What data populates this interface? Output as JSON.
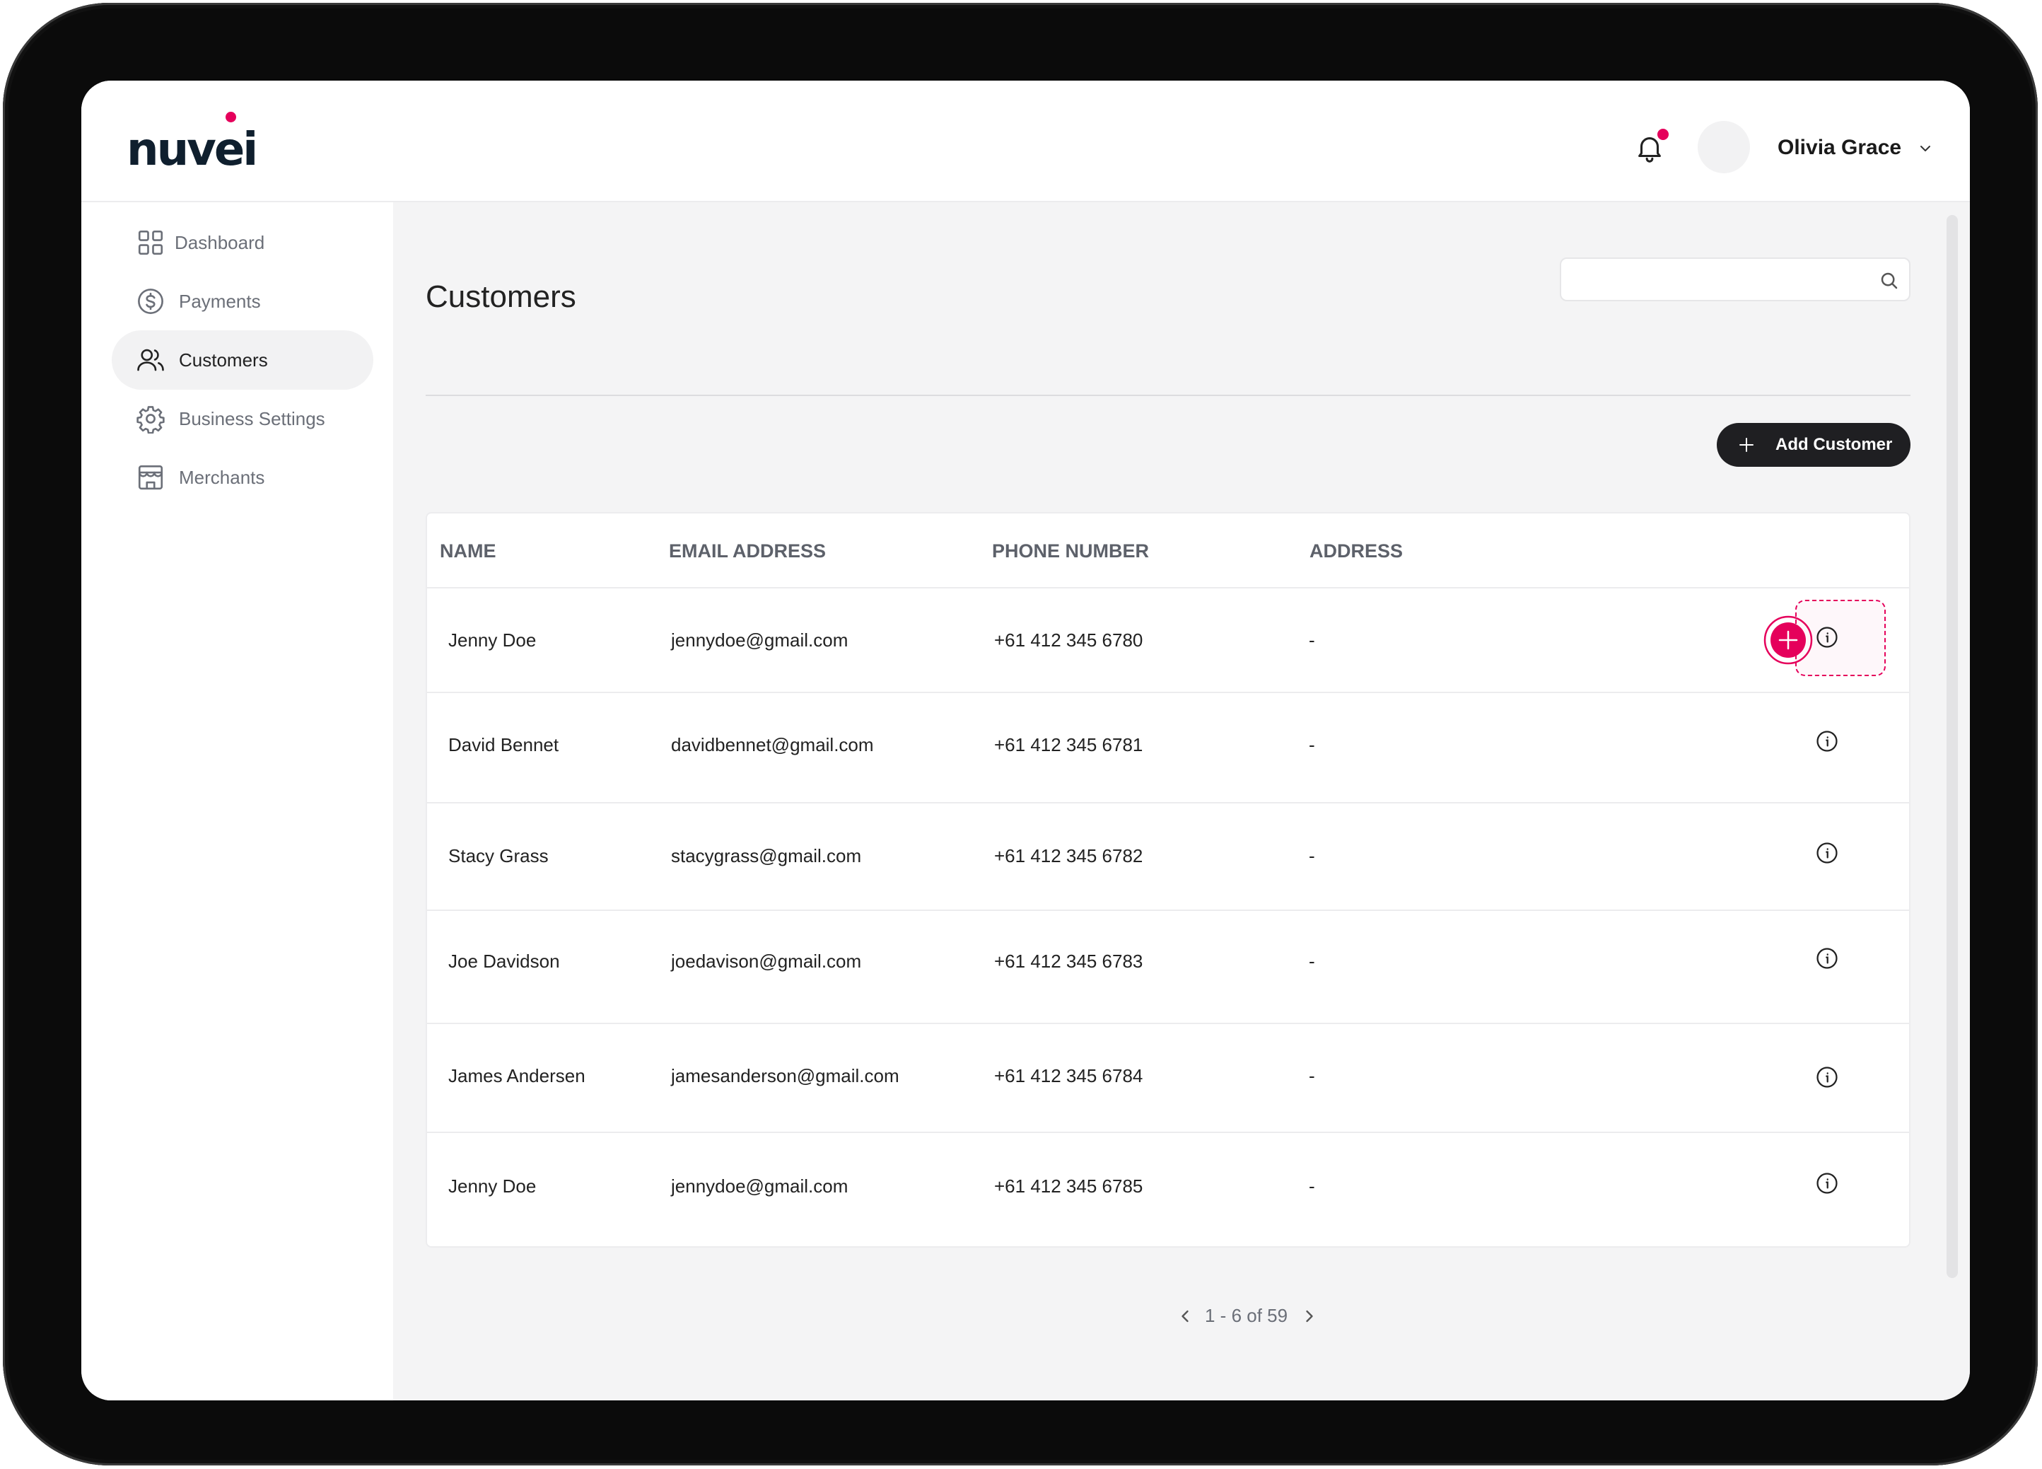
{
  "brand": {
    "name": "nuvei",
    "accent": "#e5005b"
  },
  "header": {
    "user_name": "Olivia Grace",
    "notification_icon": "bell-icon",
    "has_unread": true
  },
  "sidebar": {
    "items": [
      {
        "label": "Dashboard",
        "icon": "grid-icon",
        "active": false
      },
      {
        "label": "Payments",
        "icon": "dollar-circle-icon",
        "active": false
      },
      {
        "label": "Customers",
        "icon": "users-icon",
        "active": true
      },
      {
        "label": "Business Settings",
        "icon": "gear-icon",
        "active": false
      },
      {
        "label": "Merchants",
        "icon": "store-icon",
        "active": false
      }
    ]
  },
  "main": {
    "title": "Customers",
    "search": {
      "placeholder": "",
      "value": ""
    },
    "add_button_label": "Add Customer"
  },
  "table": {
    "columns": [
      "NAME",
      "EMAIL ADDRESS",
      "PHONE NUMBER",
      "ADDRESS"
    ],
    "rows": [
      {
        "name": "Jenny Doe",
        "email": "jennydoe@gmail.com",
        "phone": "+61 412 345 6780",
        "address": "-"
      },
      {
        "name": "David Bennet",
        "email": "davidbennet@gmail.com",
        "phone": "+61 412 345 6781",
        "address": "-"
      },
      {
        "name": "Stacy Grass",
        "email": "stacygrass@gmail.com",
        "phone": "+61 412 345 6782",
        "address": "-"
      },
      {
        "name": "Joe Davidson",
        "email": "joedavison@gmail.com",
        "phone": "+61 412 345 6783",
        "address": "-"
      },
      {
        "name": "James Andersen",
        "email": "jamesanderson@gmail.com",
        "phone": "+61 412 345 6784",
        "address": "-"
      },
      {
        "name": "Jenny Doe",
        "email": "jennydoe@gmail.com",
        "phone": "+61 412 345 6785",
        "address": "-"
      }
    ]
  },
  "pagination": {
    "text": "1 - 6 of 59"
  }
}
